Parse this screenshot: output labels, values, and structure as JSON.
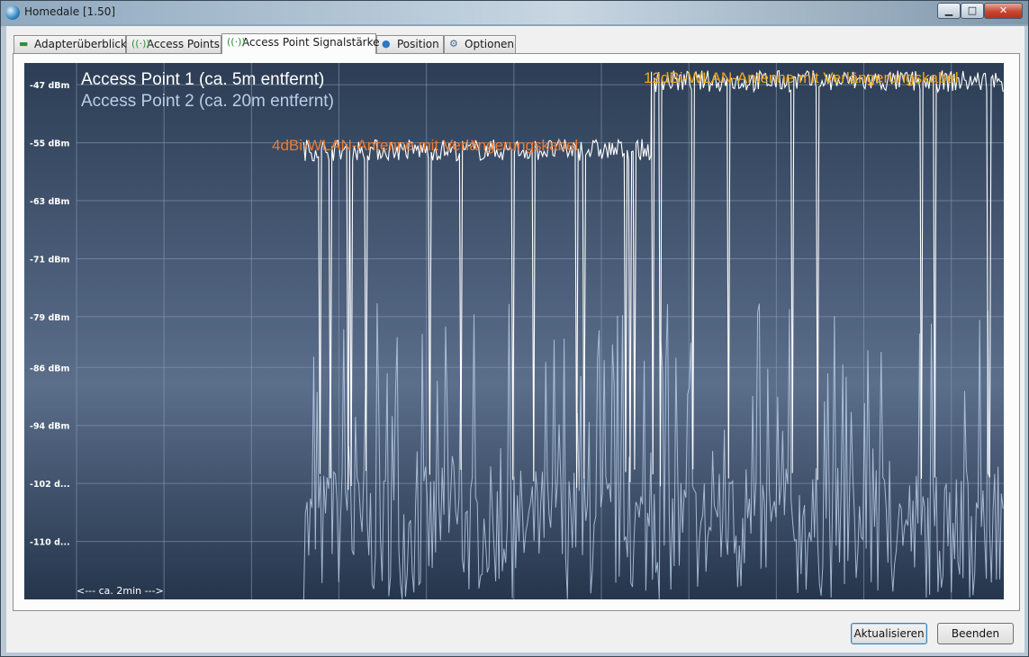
{
  "window": {
    "title": "Homedale [1.50]",
    "minimize": "▁",
    "maximize": "□",
    "close": "✕",
    "icon": "globe-icon"
  },
  "tabs": [
    {
      "label": "Adapterüberblick",
      "icon": "network-card-icon"
    },
    {
      "label": "Access Points",
      "icon": "antenna-icon"
    },
    {
      "label": "Access Point Signalstärke",
      "icon": "antenna-icon",
      "active": true
    },
    {
      "label": "Position",
      "icon": "location-pin-icon"
    },
    {
      "label": "Optionen",
      "icon": "settings-icon"
    }
  ],
  "buttons": {
    "refresh": "Aktualisieren",
    "quit": "Beenden"
  },
  "chart_data": {
    "type": "line",
    "ylabel_ticks": [
      "-47 dBm",
      "-55 dBm",
      "-63 dBm",
      "-71 dBm",
      "-79 dBm",
      "-86 dBm",
      "-94 dBm",
      "-102 d...",
      "-110 d..."
    ],
    "ylim": [
      -118,
      -44
    ],
    "grid": true,
    "x_hint": "<--- ca. 2min --->",
    "legend_position": "top-left",
    "series": [
      {
        "name": "Access Point 1 (ca. 5m entfernt)",
        "color": "#ffffff",
        "segments": [
          {
            "start": 0.245,
            "end": 0.62,
            "level": -56,
            "noise": 1.5
          },
          {
            "start": 0.62,
            "end": 1.0,
            "level": -46.5,
            "noise": 1.5
          }
        ],
        "dropout_level": -103
      },
      {
        "name": "Access Point 2 (ca. 20m entfernt)",
        "color": "#b9cde6",
        "start": 0.245,
        "range": [
          -118,
          -77
        ]
      }
    ],
    "annotations": [
      {
        "text": "4dBi-WLAN-Antenne mit Verlängerungskabel",
        "color": "#f07a2e"
      },
      {
        "text": "12dBi-WLAN-Antenne mit Verlängerungskabel",
        "color": "#f0a818"
      }
    ],
    "colors": {
      "background_top": "#2c3d55",
      "background_mid": "#5b6e8a",
      "background_bottom": "#25354c",
      "grid": "#8fa2ba",
      "tick_text": "#ffffff"
    }
  }
}
